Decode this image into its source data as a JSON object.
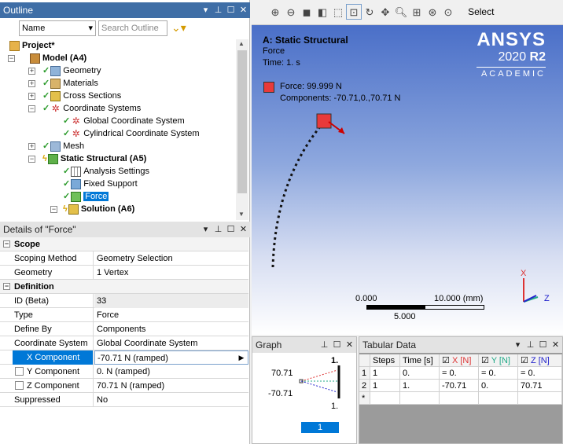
{
  "outline": {
    "title": "Outline",
    "filter_select": "Name",
    "search_placeholder": "Search Outline",
    "tree": [
      {
        "label": "Project*",
        "bold": true
      },
      {
        "label": "Model (A4)",
        "bold": true
      },
      {
        "label": "Geometry"
      },
      {
        "label": "Materials"
      },
      {
        "label": "Cross Sections"
      },
      {
        "label": "Coordinate Systems"
      },
      {
        "label": "Global Coordinate System"
      },
      {
        "label": "Cylindrical Coordinate System"
      },
      {
        "label": "Mesh"
      },
      {
        "label": "Static Structural (A5)",
        "bold": true
      },
      {
        "label": "Analysis Settings"
      },
      {
        "label": "Fixed Support"
      },
      {
        "label": "Force",
        "selected": true
      },
      {
        "label": "Solution (A6)",
        "bold": true
      }
    ]
  },
  "details": {
    "title": "Details of \"Force\"",
    "rows": [
      {
        "section": "Scope"
      },
      {
        "key": "Scoping Method",
        "value": "Geometry Selection"
      },
      {
        "key": "Geometry",
        "value": "1 Vertex"
      },
      {
        "section": "Definition"
      },
      {
        "key": "ID (Beta)",
        "value": "33"
      },
      {
        "key": "Type",
        "value": "Force"
      },
      {
        "key": "Define By",
        "value": "Components"
      },
      {
        "key": "Coordinate System",
        "value": "Global Coordinate System"
      },
      {
        "key": "X Component",
        "value": "-70.71 N  (ramped)",
        "selected": true
      },
      {
        "key": "Y Component",
        "value": "0. N  (ramped)"
      },
      {
        "key": "Z Component",
        "value": "70.71 N  (ramped)"
      },
      {
        "key": "Suppressed",
        "value": "No"
      }
    ]
  },
  "toolbar": {
    "select_label": "Select"
  },
  "viewport": {
    "analysis_title": "A: Static Structural",
    "load_name": "Force",
    "time": "Time: 1. s",
    "legend_force": "Force: 99.999 N",
    "legend_components": "Components: -70.71,0.,70.71 N",
    "legend_color": "#e83a3a",
    "brand": "ANSYS",
    "version_year": "2020",
    "version_release": "R2",
    "edition": "ACADEMIC",
    "scale_left": "0.000",
    "scale_right": "10.000 (mm)",
    "scale_mid": "5.000",
    "axis_x": "X",
    "axis_z": "Z"
  },
  "graph": {
    "title": "Graph",
    "y_top": "70.71",
    "y_bottom": "-70.71",
    "t_top": "1.",
    "t_bottom": "1.",
    "step": "1"
  },
  "tabular": {
    "title": "Tabular Data",
    "headers": [
      "Steps",
      "Time [s]",
      "X [N]",
      "Y [N]",
      "Z [N]"
    ],
    "rows": [
      [
        "1",
        "1",
        "0.",
        "= 0.",
        "= 0.",
        "= 0."
      ],
      [
        "2",
        "1",
        "1.",
        "-70.71",
        "0.",
        "70.71"
      ],
      [
        "*",
        "",
        "",
        "",
        "",
        ""
      ]
    ]
  }
}
